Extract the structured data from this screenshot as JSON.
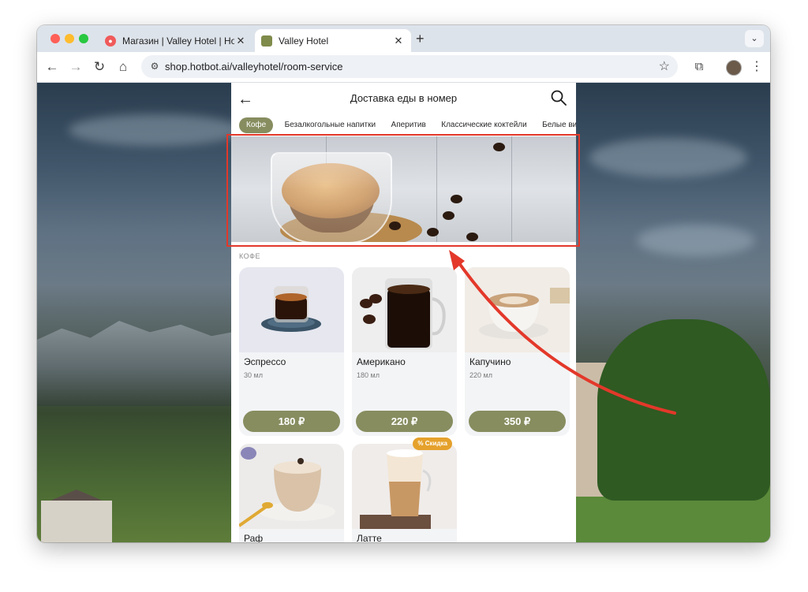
{
  "browser": {
    "tabs": [
      {
        "title": "Магазин | Valley Hotel | Hotb",
        "active": false
      },
      {
        "title": "Valley Hotel",
        "active": true
      }
    ],
    "url": "shop.hotbot.ai/valleyhotel/room-service"
  },
  "page": {
    "title": "Доставка еды в номер",
    "categories": [
      "Кофе",
      "Безалкогольные напитки",
      "Аперитив",
      "Классические коктейли",
      "Белые вин"
    ],
    "active_category": "Кофе",
    "section_label": "КОФЕ",
    "products": [
      {
        "name": "Эспрессо",
        "volume": "30 мл",
        "price": "180 ₽"
      },
      {
        "name": "Американо",
        "volume": "180 мл",
        "price": "220 ₽"
      },
      {
        "name": "Капучино",
        "volume": "220 мл",
        "price": "350 ₽"
      },
      {
        "name": "Раф",
        "volume": "",
        "price": ""
      },
      {
        "name": "Латте",
        "volume": "",
        "price": "",
        "badge": "% Скидка"
      }
    ]
  },
  "colors": {
    "accent": "#878d5f",
    "highlight": "#e3382a",
    "discount": "#e5a12c"
  }
}
